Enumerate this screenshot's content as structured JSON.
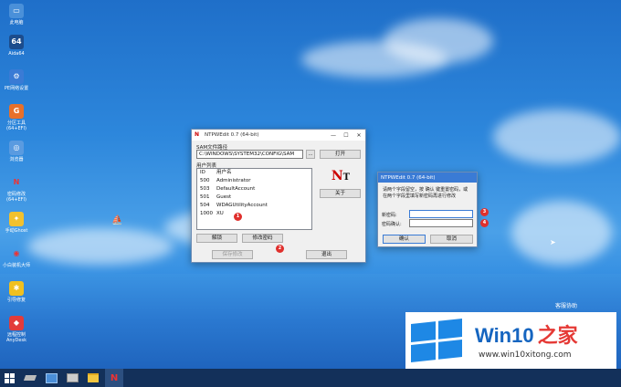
{
  "desktop": {
    "icons": [
      {
        "label": "此电脑",
        "icon": "computer-icon",
        "color": "#4a90d9",
        "glyph": "▭"
      },
      {
        "label": "Aida64",
        "icon": "aida64-icon",
        "color": "#1c4c8c",
        "glyph": "64"
      },
      {
        "label": "PE网络设置",
        "icon": "network-icon",
        "color": "#3a7bd5",
        "glyph": "⚙"
      },
      {
        "label": "分区工具\n(64+EFI)",
        "icon": "partition-tool-icon",
        "color": "#e8702a",
        "glyph": "G"
      },
      {
        "label": "浏览器",
        "icon": "browser-icon",
        "color": "#5a9be0",
        "glyph": "◎"
      },
      {
        "label": "密码修改\n(64+EFI)",
        "icon": "password-tool-icon",
        "color": "#ffffff",
        "glyph": "N"
      },
      {
        "label": "手动Ghost",
        "icon": "ghost-icon",
        "color": "#f2c12e",
        "glyph": "✦"
      },
      {
        "label": "小白装机大师",
        "icon": "installer-icon",
        "color": "#ffffff",
        "glyph": "◉"
      },
      {
        "label": "引导修复",
        "icon": "boot-repair-icon",
        "color": "#f0c020",
        "glyph": "✱"
      },
      {
        "label": "远程控制\nAnyDesk",
        "icon": "anydesk-icon",
        "color": "#e23b3b",
        "glyph": "◆"
      }
    ]
  },
  "main_window": {
    "title": "NTPWEdit 0.7 (64-bit)",
    "sam_label": "SAM文件路径",
    "sam_path": "C:\\WINDOWS\\SYSTEM32\\CONFIG\\SAM",
    "browse_label": "...",
    "open_label": "打开",
    "users_label": "用户列表",
    "columns": [
      "ID",
      "用户名"
    ],
    "users": [
      {
        "id": "500",
        "name": "Administrator"
      },
      {
        "id": "503",
        "name": "DefaultAccount"
      },
      {
        "id": "501",
        "name": "Guest"
      },
      {
        "id": "504",
        "name": "WDAGUtilityAccount"
      },
      {
        "id": "1000",
        "name": "XU"
      }
    ],
    "about_label": "关于",
    "unlock_label": "解锁",
    "change_pw_label": "修改密码",
    "save_label": "保存修改",
    "exit_label": "退出"
  },
  "dialog": {
    "title": "NTPWEdit 0.7 (64-bit)",
    "instruction": "请两个字段留空，按 确认 键重置密码，或在两个字段里填写新密码再进行修改",
    "new_pw_label": "新密码:",
    "confirm_pw_label": "密码确认:",
    "new_pw_value": "",
    "confirm_pw_value": "",
    "ok_label": "确认",
    "cancel_label": "取消"
  },
  "badges": [
    "1",
    "2",
    "3",
    "4"
  ],
  "watermark": {
    "helper_text": "客服协助",
    "brand": "Win10",
    "brand_cn": "之家",
    "url": "www.win10xitong.com"
  },
  "colors": {
    "badge": "#e0302d",
    "accent": "#0078d7"
  }
}
